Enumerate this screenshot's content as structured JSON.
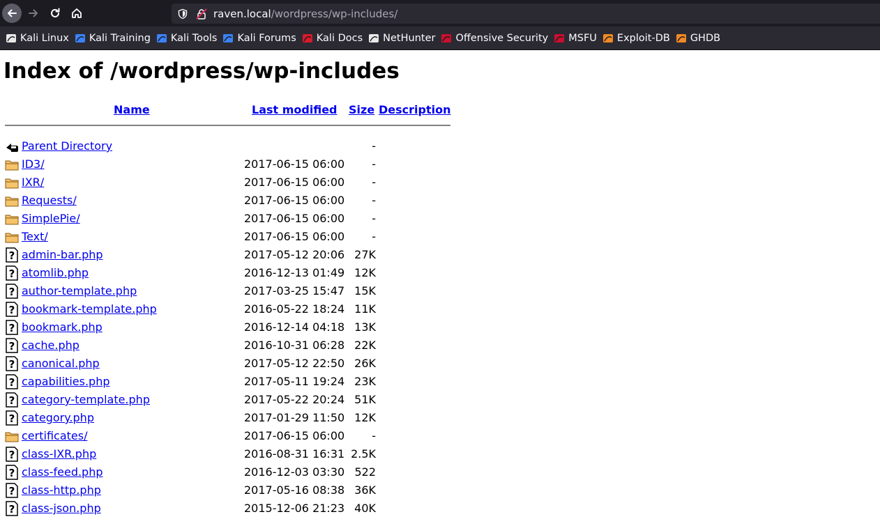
{
  "browser": {
    "url_host": "raven.local",
    "url_path": "/wordpress/wp-includes/",
    "bookmarks": [
      {
        "label": "Kali Linux",
        "icon": "kali-icon"
      },
      {
        "label": "Kali Training",
        "icon": "kali-training-icon"
      },
      {
        "label": "Kali Tools",
        "icon": "kali-tools-icon"
      },
      {
        "label": "Kali Forums",
        "icon": "kali-forums-icon"
      },
      {
        "label": "Kali Docs",
        "icon": "kali-docs-icon"
      },
      {
        "label": "NetHunter",
        "icon": "nethunter-icon"
      },
      {
        "label": "Offensive Security",
        "icon": "offsec-icon"
      },
      {
        "label": "MSFU",
        "icon": "msfu-icon"
      },
      {
        "label": "Exploit-DB",
        "icon": "exploitdb-icon"
      },
      {
        "label": "GHDB",
        "icon": "ghdb-icon"
      }
    ]
  },
  "page": {
    "title": "Index of /wordpress/wp-includes",
    "columns": {
      "name": "Name",
      "last_modified": "Last modified",
      "size": "Size",
      "description": "Description"
    },
    "entries": [
      {
        "name": "Parent Directory",
        "date": "",
        "size": "-",
        "icon": "back-icon"
      },
      {
        "name": "ID3/",
        "date": "2017-06-15 06:00",
        "size": "-",
        "icon": "folder-icon"
      },
      {
        "name": "IXR/",
        "date": "2017-06-15 06:00",
        "size": "-",
        "icon": "folder-icon"
      },
      {
        "name": "Requests/",
        "date": "2017-06-15 06:00",
        "size": "-",
        "icon": "folder-icon"
      },
      {
        "name": "SimplePie/",
        "date": "2017-06-15 06:00",
        "size": "-",
        "icon": "folder-icon"
      },
      {
        "name": "Text/",
        "date": "2017-06-15 06:00",
        "size": "-",
        "icon": "folder-icon"
      },
      {
        "name": "admin-bar.php",
        "date": "2017-05-12 20:06",
        "size": "27K",
        "icon": "unknown-file-icon"
      },
      {
        "name": "atomlib.php",
        "date": "2016-12-13 01:49",
        "size": "12K",
        "icon": "unknown-file-icon"
      },
      {
        "name": "author-template.php",
        "date": "2017-03-25 15:47",
        "size": "15K",
        "icon": "unknown-file-icon"
      },
      {
        "name": "bookmark-template.php",
        "date": "2016-05-22 18:24",
        "size": "11K",
        "icon": "unknown-file-icon"
      },
      {
        "name": "bookmark.php",
        "date": "2016-12-14 04:18",
        "size": "13K",
        "icon": "unknown-file-icon"
      },
      {
        "name": "cache.php",
        "date": "2016-10-31 06:28",
        "size": "22K",
        "icon": "unknown-file-icon"
      },
      {
        "name": "canonical.php",
        "date": "2017-05-12 22:50",
        "size": "26K",
        "icon": "unknown-file-icon"
      },
      {
        "name": "capabilities.php",
        "date": "2017-05-11 19:24",
        "size": "23K",
        "icon": "unknown-file-icon"
      },
      {
        "name": "category-template.php",
        "date": "2017-05-22 20:24",
        "size": "51K",
        "icon": "unknown-file-icon"
      },
      {
        "name": "category.php",
        "date": "2017-01-29 11:50",
        "size": "12K",
        "icon": "unknown-file-icon"
      },
      {
        "name": "certificates/",
        "date": "2017-06-15 06:00",
        "size": "-",
        "icon": "folder-icon"
      },
      {
        "name": "class-IXR.php",
        "date": "2016-08-31 16:31",
        "size": "2.5K",
        "icon": "unknown-file-icon"
      },
      {
        "name": "class-feed.php",
        "date": "2016-12-03 03:30",
        "size": "522",
        "icon": "unknown-file-icon"
      },
      {
        "name": "class-http.php",
        "date": "2017-05-16 08:38",
        "size": "36K",
        "icon": "unknown-file-icon"
      },
      {
        "name": "class-json.php",
        "date": "2015-12-06 21:23",
        "size": "40K",
        "icon": "unknown-file-icon"
      }
    ]
  }
}
